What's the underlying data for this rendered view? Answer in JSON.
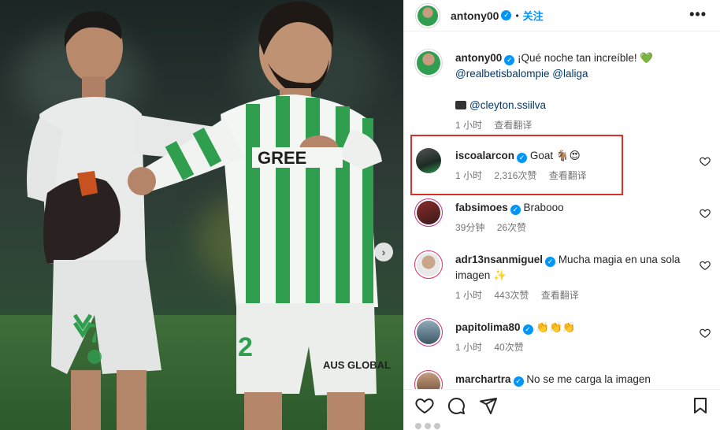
{
  "post": {
    "author": "antony00",
    "follow_label": "关注",
    "more_label": "•••",
    "next_label": "›"
  },
  "caption": {
    "user": "antony00",
    "text": "¡Qué noche tan increíble! 💚",
    "mentions": "@realbetisbalompie @laliga",
    "photo_credit": "@cleyton.ssiilva",
    "time": "1 小时",
    "translate": "查看翻译"
  },
  "comments": [
    {
      "user": "iscoalarcon",
      "verified": true,
      "text": "Goat 🐐😍",
      "time": "1 小时",
      "likes": "2,316次赞",
      "translate": "查看翻译"
    },
    {
      "user": "fabsimoes",
      "verified": true,
      "text": "Brabooo",
      "time": "39分钟",
      "likes": "26次赞",
      "translate": ""
    },
    {
      "user": "adr13nsanmiguel",
      "verified": true,
      "text": "Mucha magia en una sola imagen ✨",
      "time": "1 小时",
      "likes": "443次赞",
      "translate": "查看翻译"
    },
    {
      "user": "papitolima80",
      "verified": true,
      "text": "👏👏👏",
      "time": "1 小时",
      "likes": "40次赞",
      "translate": ""
    },
    {
      "user": "marchartra",
      "verified": true,
      "text": "No se me carga la imagen",
      "time": "",
      "likes": "",
      "translate": ""
    }
  ],
  "photo_text": {
    "shirt_sponsor": "GREE",
    "shorts_left_number": "7",
    "shorts_right_number": "2",
    "shorts_sponsor": "AUS GLOBAL"
  },
  "colors": {
    "accent": "#0095f6",
    "mention": "#00376b",
    "highlight_box": "#d9302a",
    "betis_green": "#2f9e4f"
  },
  "icons": {
    "like": "heart-icon",
    "comment": "comment-icon",
    "share": "share-icon",
    "save": "bookmark-icon"
  }
}
